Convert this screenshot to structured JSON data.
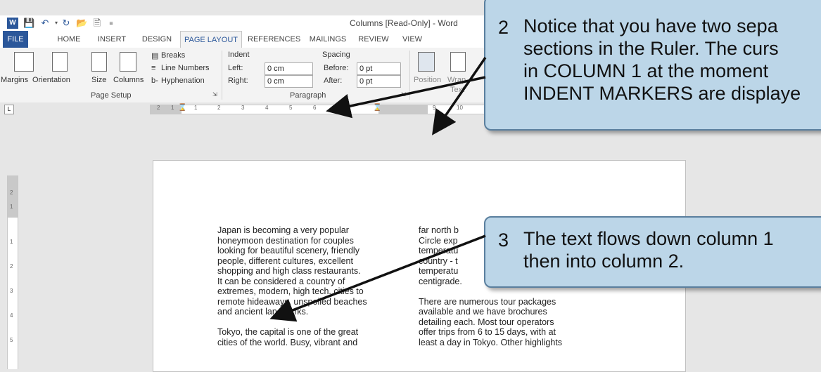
{
  "window": {
    "title": "Columns [Read-Only] - Word",
    "qat_icons": [
      "word-logo-icon",
      "save-icon",
      "undo-icon",
      "redo-icon",
      "open-folder-icon",
      "new-document-icon",
      "customize-icon"
    ]
  },
  "tabs": [
    "FILE",
    "HOME",
    "INSERT",
    "DESIGN",
    "PAGE LAYOUT",
    "REFERENCES",
    "MAILINGS",
    "REVIEW",
    "VIEW"
  ],
  "active_tab": "PAGE LAYOUT",
  "ribbon": {
    "page_setup": {
      "margins": "Margins",
      "orientation": "Orientation",
      "size": "Size",
      "columns": "Columns",
      "breaks": "Breaks",
      "line_numbers": "Line Numbers",
      "hyphenation": "Hyphenation",
      "group_name": "Page Setup"
    },
    "paragraph": {
      "indent_label": "Indent",
      "left_label": "Left:",
      "left_value": "0 cm",
      "right_label": "Right:",
      "right_value": "0 cm",
      "spacing_label": "Spacing",
      "before_label": "Before:",
      "before_value": "0 pt",
      "after_label": "After:",
      "after_value": "0 pt",
      "group_name": "Paragraph"
    },
    "arrange": {
      "position": "Position",
      "wrap_text": "Wrap",
      "wrap_text_2": "Text"
    }
  },
  "ruler_ticks": [
    "2",
    "1",
    "1",
    "2",
    "3",
    "4",
    "5",
    "6",
    "7",
    "9",
    "10"
  ],
  "vruler_ticks": [
    "2",
    "1",
    "1",
    "2",
    "3",
    "4",
    "5"
  ],
  "document": {
    "column1": [
      [
        "Japan is becoming a very popular",
        "honeymoon destination for couples",
        "looking for beautiful scenery, friendly",
        "people, different cultures, excellent",
        "shopping and high class restaurants.",
        "It can be considered a country of",
        "extremes, modern, high tech. cities to",
        "remote hideaways, unspoiled beaches",
        "and ancient landmarks."
      ],
      [
        "Tokyo, the capital is one of the great",
        "cities of the world.  Busy, vibrant and"
      ]
    ],
    "column2": [
      [
        "far north b",
        "Circle exp",
        "temperatu",
        "country - t",
        "temperatu",
        "centigrade."
      ],
      [
        "There are numerous tour packages",
        "available and we have brochures",
        "detailing each.  Most tour operators",
        "offer trips from 6 to 15 days, with at",
        "least a day in Tokyo.  Other highlights"
      ]
    ]
  },
  "callouts": {
    "c2": {
      "number": "2",
      "lines": [
        "Notice that you have two sepa",
        "sections in the Ruler.  The curs",
        "in COLUMN 1 at the moment",
        "INDENT MARKERS are displaye"
      ]
    },
    "c3": {
      "number": "3",
      "lines": [
        "The text flows down column 1",
        "then into column 2."
      ]
    }
  }
}
